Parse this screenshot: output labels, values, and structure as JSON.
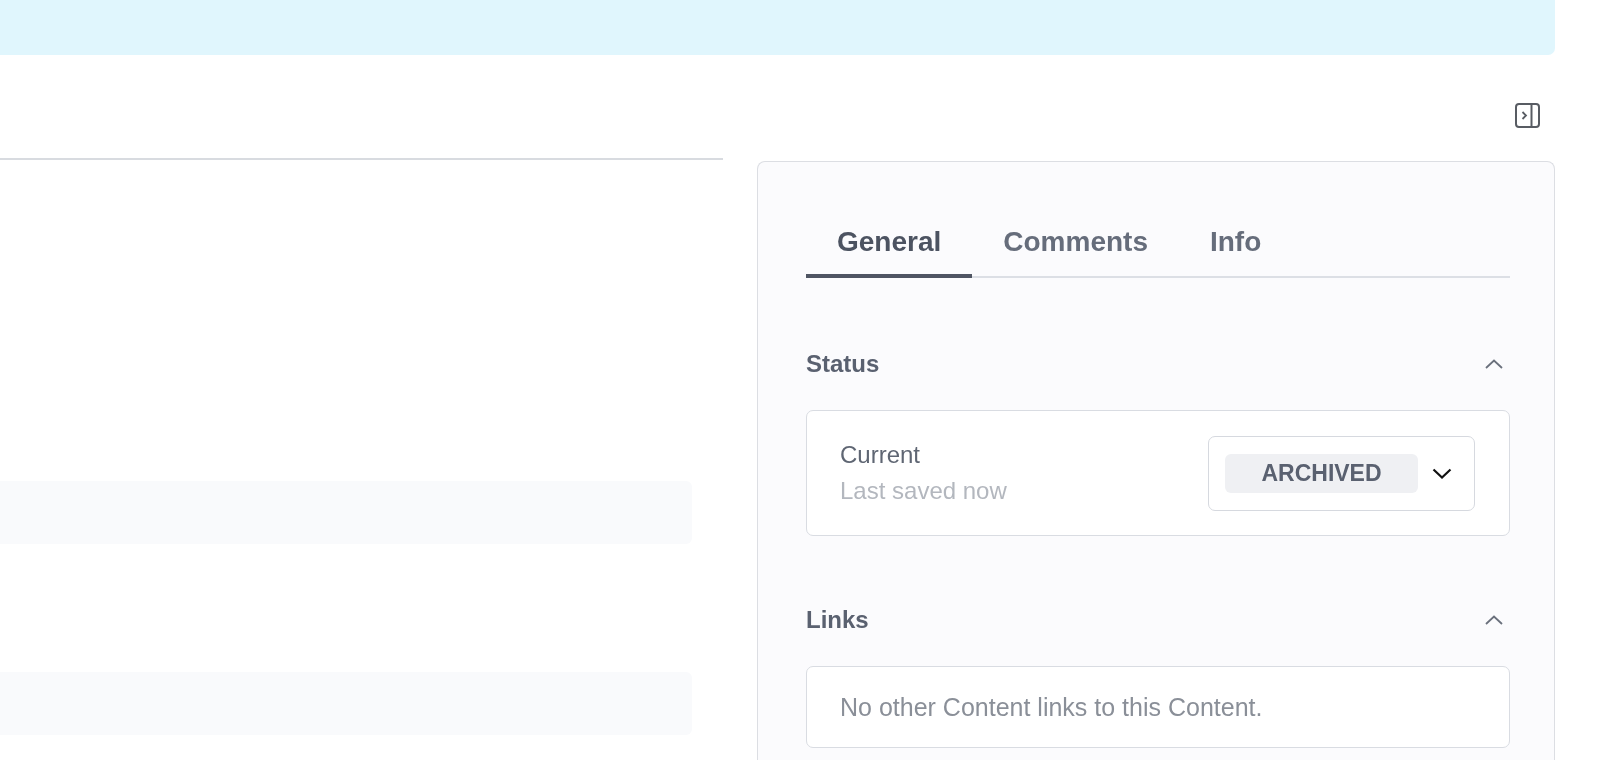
{
  "tabs": [
    {
      "label": "General",
      "selected": true
    },
    {
      "label": "Comments",
      "selected": false
    },
    {
      "label": "Info",
      "selected": false
    }
  ],
  "sections": [
    {
      "kind": "status",
      "title": "Status",
      "expanded": true,
      "label": "Current",
      "note": "Last saved now",
      "value": "ARCHIVED"
    },
    {
      "kind": "links",
      "title": "Links",
      "expanded": true,
      "message": "No other Content links to this Content."
    }
  ]
}
